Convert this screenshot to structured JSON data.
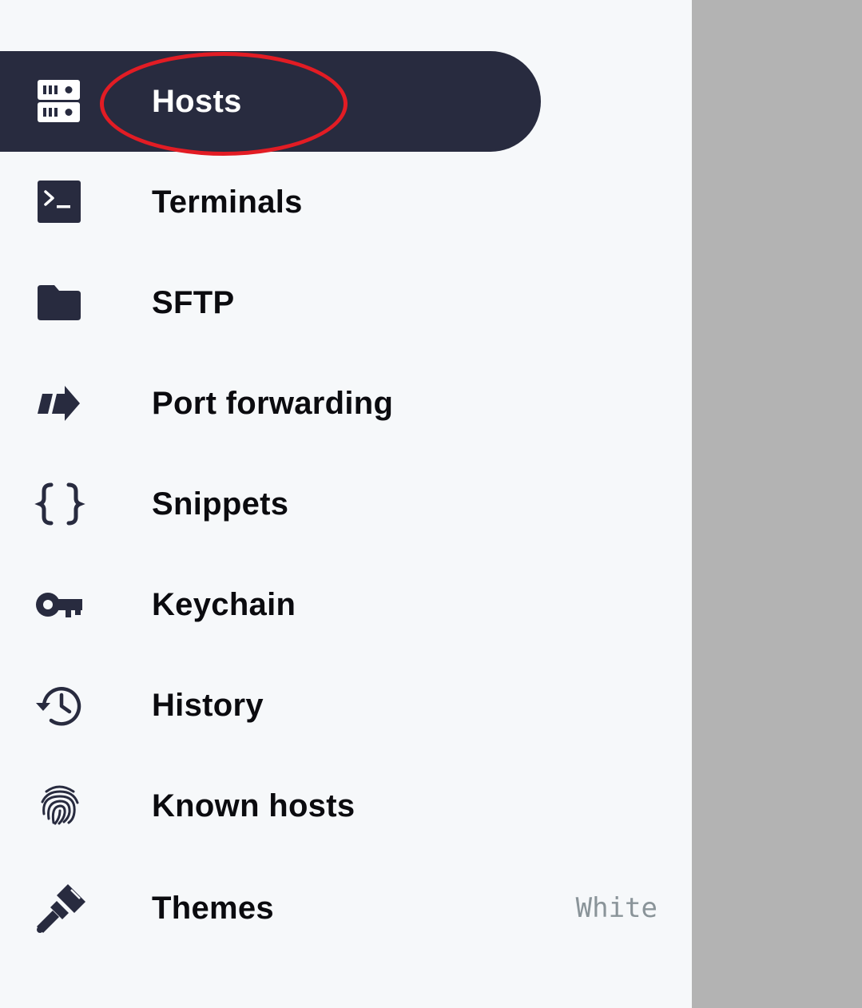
{
  "nav": {
    "items": [
      {
        "label": "Hosts",
        "icon": "server-icon",
        "active": true
      },
      {
        "label": "Terminals",
        "icon": "terminal-icon"
      },
      {
        "label": "SFTP",
        "icon": "folder-icon"
      },
      {
        "label": "Port forwarding",
        "icon": "port-forward-icon"
      },
      {
        "label": "Snippets",
        "icon": "curly-braces-icon"
      },
      {
        "label": "Keychain",
        "icon": "key-icon"
      },
      {
        "label": "History",
        "icon": "history-icon"
      },
      {
        "label": "Known hosts",
        "icon": "fingerprint-icon"
      },
      {
        "label": "Themes",
        "icon": "paintbrush-icon",
        "value": "White"
      }
    ]
  },
  "colors": {
    "drawer_bg": "#f6f8fa",
    "active_bg": "#282b3f",
    "scrim": "#b3b3b3",
    "annotation": "#e21c24",
    "icon": "#282b3f"
  }
}
